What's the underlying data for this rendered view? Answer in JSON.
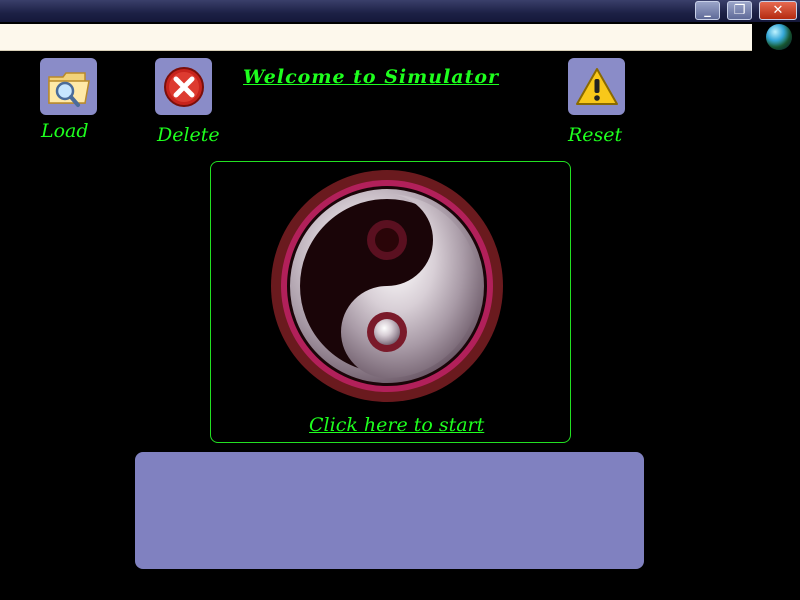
{
  "window": {
    "minimize_glyph": "_",
    "restore_glyph": "❐",
    "close_glyph": "✕"
  },
  "address_bar": {
    "value": ""
  },
  "browser_icon": "globe-icon",
  "toolbar": {
    "load_label": "Load",
    "load_icon": "folder-search-icon",
    "delete_label": "Delete",
    "delete_icon": "delete-x-icon",
    "reset_label": "Reset",
    "reset_icon": "warning-icon"
  },
  "header": {
    "title": "Welcome to Simulator"
  },
  "main": {
    "image_icon": "yin-yang-icon",
    "start_link": "Click here to start"
  },
  "colors": {
    "background": "#000000",
    "text_green": "#1eff1e",
    "tile_bg": "#8a8cc8",
    "bottom_panel": "#8081c0"
  }
}
